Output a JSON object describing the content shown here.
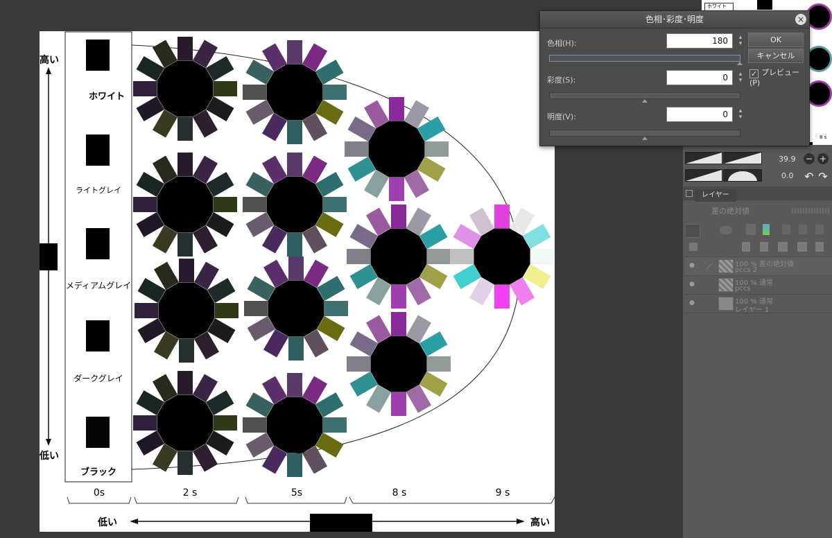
{
  "art": {
    "value_axis": {
      "high": "高い",
      "low": "低い"
    },
    "chroma_axis": {
      "low": "低い",
      "high": "高い"
    },
    "gray_labels": [
      "ホワイト",
      "ライトグレイ",
      "メディアムグレイ",
      "ダークグレイ",
      "ブラック"
    ],
    "group_labels": [
      "0s",
      "2 s",
      "5s",
      "8 s",
      "9 s"
    ]
  },
  "dialog": {
    "title": "色相･彩度･明度",
    "hue_label": "色相(H):",
    "hue_value": "180",
    "sat_label": "彩度(S):",
    "sat_value": "0",
    "light_label": "明度(V):",
    "light_value": "0",
    "ok": "OK",
    "cancel": "キャンセル",
    "preview": "プレビュー(P)"
  },
  "panel": {
    "value_a": "39.9",
    "value_b": "0.0",
    "layers_tab": "レイヤー",
    "blend_mode": "差の絶対値",
    "layers": [
      {
        "line1": "100 % 差の絶対値",
        "line2": "pccs 2"
      },
      {
        "line1": "100 % 通常",
        "line2": "pccs"
      },
      {
        "line1": "100 % 通常",
        "line2": "レイヤー 1"
      }
    ],
    "thumb_label": "ホワイト",
    "thumb_caption": "8 s"
  },
  "colors": {
    "bg": "#3a3a3a",
    "panel": "#595959",
    "dialog": "#4c4c4c"
  }
}
